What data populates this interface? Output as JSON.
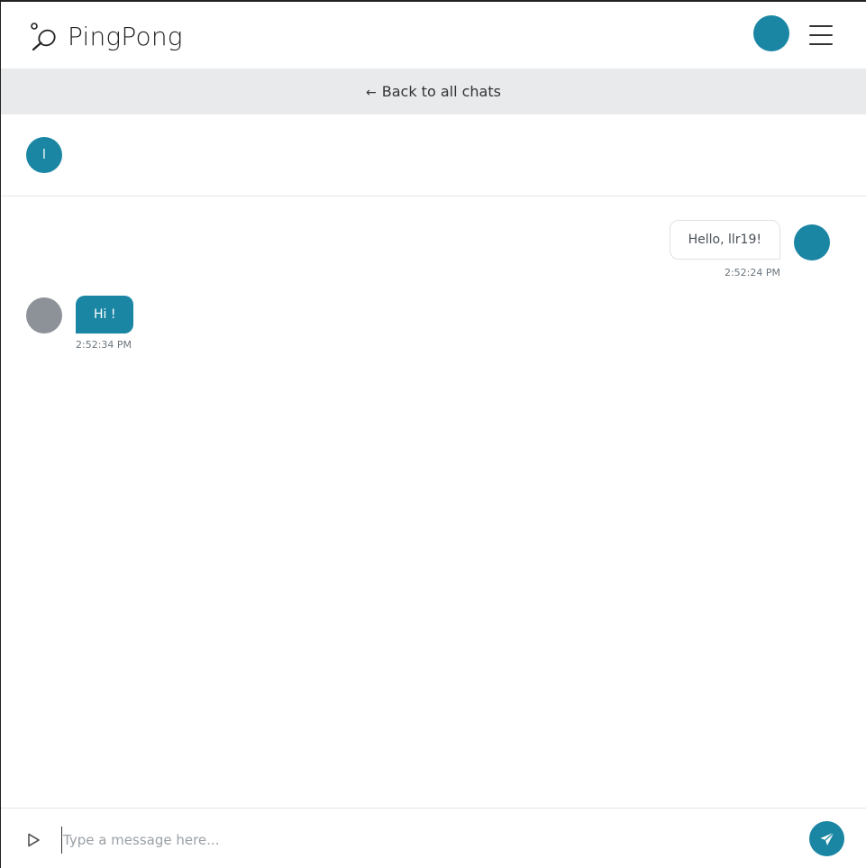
{
  "app": {
    "name": "PingPong"
  },
  "header": {
    "logo_text": "PingPong",
    "avatar_color": "#1a86a3",
    "menu_icon": "hamburger-icon"
  },
  "back_bar": {
    "arrow": "←",
    "label": "Back to all chats"
  },
  "chat": {
    "partner_initial": "l",
    "avatar_color": "#1a86a3"
  },
  "messages": [
    {
      "direction": "outgoing",
      "text": "Hello, llr19!",
      "time": "2:52:24 PM",
      "avatar_color": "#1a86a3"
    },
    {
      "direction": "incoming",
      "text": "Hi !",
      "time": "2:52:34 PM",
      "avatar_color": "#8c9297",
      "bubble_color": "#1a86a3"
    }
  ],
  "composer": {
    "placeholder": "Type a message here...",
    "value": "",
    "attach_icon": "play-icon",
    "send_icon": "paper-plane-icon",
    "send_color": "#1a86a3"
  }
}
